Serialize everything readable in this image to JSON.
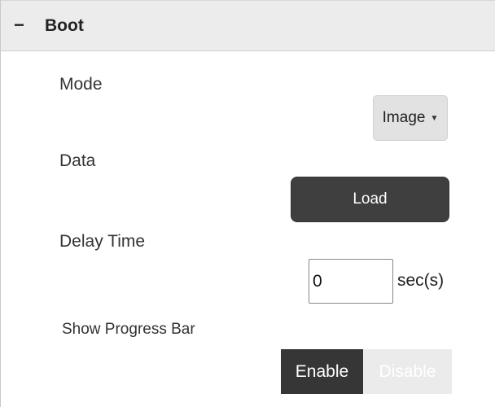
{
  "section": {
    "title": "Boot",
    "collapse_symbol": "−",
    "collapse_icon": "minus-icon"
  },
  "fields": {
    "mode": {
      "label": "Mode",
      "selected": "Image",
      "dropdown_icon": "caret-down-icon"
    },
    "data": {
      "label": "Data",
      "button_label": "Load"
    },
    "delay_time": {
      "label": "Delay Time",
      "value": "0",
      "unit": "sec(s)"
    },
    "show_progress_bar": {
      "label": "Show Progress Bar",
      "options": [
        "Enable",
        "Disable"
      ],
      "selected": "Enable"
    }
  },
  "colors": {
    "header_bg": "#ececec",
    "button_dark": "#3f3f3f",
    "toggle_active": "#363636",
    "toggle_inactive": "#ebebeb"
  }
}
